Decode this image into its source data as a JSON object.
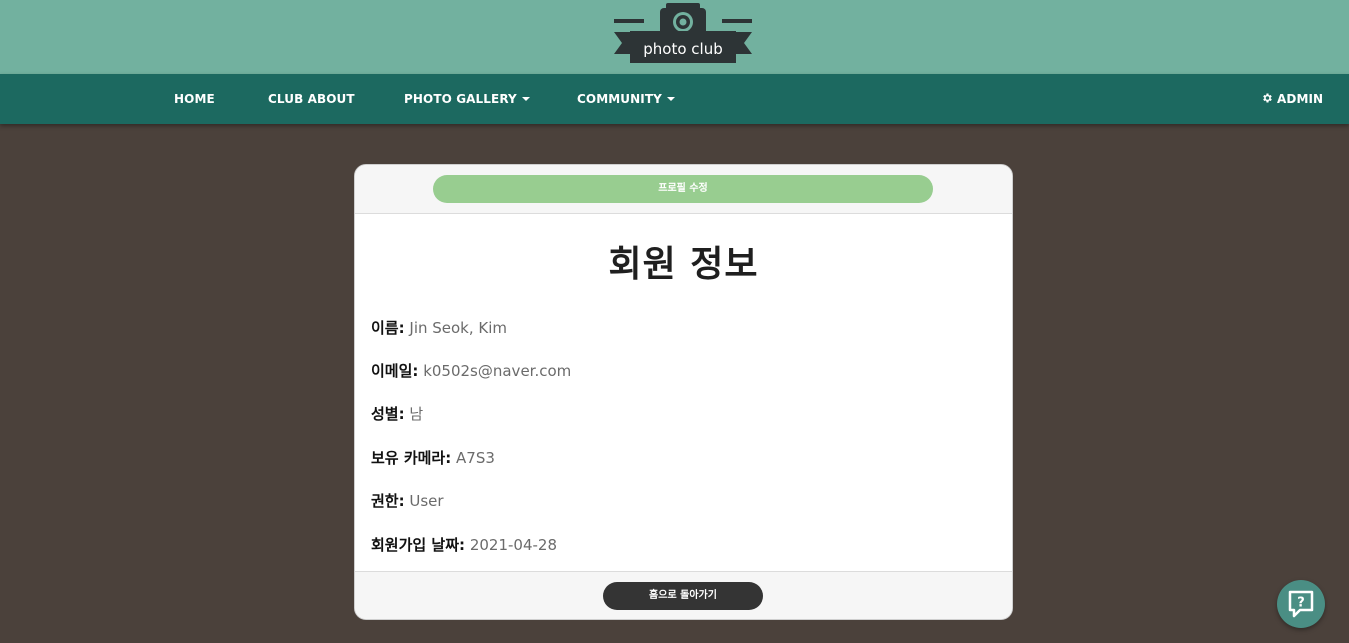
{
  "logo": {
    "text": "photo club"
  },
  "nav": {
    "home": "HOME",
    "club_about": "CLUB ABOUT",
    "photo_gallery": "PHOTO GALLERY",
    "community": "COMMUNITY",
    "admin": "ADMIN"
  },
  "card": {
    "edit_button": "프로필 수정",
    "title": "회원 정보",
    "fields": [
      {
        "label": "이름:",
        "value": "Jin Seok, Kim"
      },
      {
        "label": "이메일:",
        "value": "k0502s@naver.com"
      },
      {
        "label": "성별:",
        "value": "남"
      },
      {
        "label": "보유 카메라:",
        "value": "A7S3"
      },
      {
        "label": "권한:",
        "value": "User"
      },
      {
        "label": "회원가입 날짜:",
        "value": "2021-04-28"
      }
    ],
    "home_button": "홈으로 돌아가기"
  },
  "icons": {
    "logo": "camera-icon",
    "settings": "gear-icon",
    "help": "help-chat-icon"
  },
  "colors": {
    "top_band": "#72b19f",
    "navbar": "#1c6960",
    "background": "#4b413b",
    "edit_button": "#98cd90",
    "home_button": "#343434",
    "help_fab": "#4a8e84"
  }
}
